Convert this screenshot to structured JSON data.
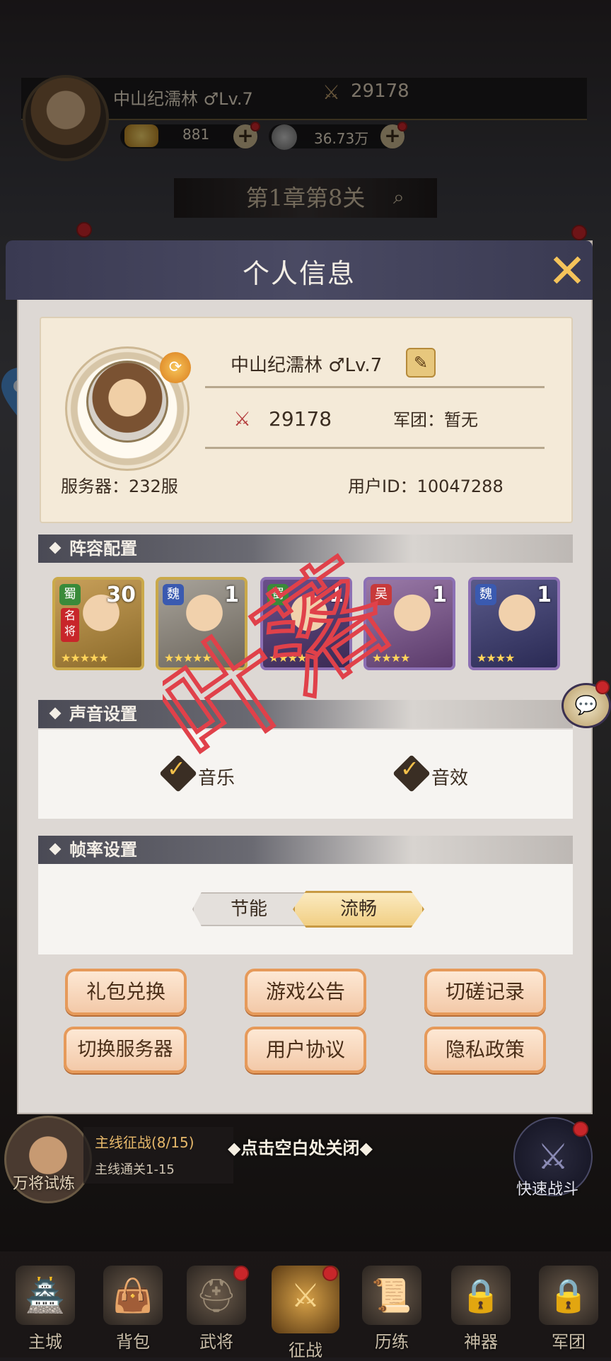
{
  "hud": {
    "name_level": "中山纪濡林 ♂Lv.7",
    "power": "29178",
    "gold": "881",
    "silver": "36.73万",
    "chapter": "第1章第8关"
  },
  "modal": {
    "title": "个人信息",
    "profile": {
      "name_level": "中山纪濡林 ♂Lv.7",
      "power": "29178",
      "legion": "军团：暂无",
      "server": "服务器：232服",
      "uid": "用户ID：10047288"
    },
    "sections": {
      "lineup": "阵容配置",
      "sound": "声音设置",
      "framerate": "帧率设置"
    },
    "heroes": [
      {
        "faction": "蜀",
        "level": "30",
        "badge": "名将",
        "stars": "★★★★★"
      },
      {
        "faction": "魏",
        "level": "1",
        "stars": "★★★★★"
      },
      {
        "faction": "蜀",
        "level": "1",
        "stars": "★★★★"
      },
      {
        "faction": "吴",
        "level": "1",
        "stars": "★★★★"
      },
      {
        "faction": "魏",
        "level": "1",
        "stars": "★★★★"
      }
    ],
    "sound": {
      "music": "音乐",
      "sfx": "音效",
      "music_checked": true,
      "sfx_checked": true
    },
    "framerate": {
      "options": [
        "节能",
        "流畅"
      ],
      "selected": "流畅"
    },
    "buttons": {
      "gift": "礼包兑换",
      "notice": "游戏公告",
      "spar": "切磋记录",
      "switch_server": "切换服务器",
      "agreement": "用户协议",
      "privacy": "隐私政策"
    }
  },
  "watermark": "叶落",
  "below": {
    "close_hint": "◆点击空白处关闭◆",
    "quest_title": "主线征战(8/15)",
    "quest_sub": "主线通关1-15",
    "left_label": "万将试炼",
    "right_label": "快速战斗"
  },
  "nav": [
    "主城",
    "背包",
    "武将",
    "征战",
    "历练",
    "神器",
    "军团"
  ],
  "colors": {
    "accent": "#e69a5a",
    "header": "#3a3a52",
    "watermark": "#e0414a",
    "red_dot": "#c8262a"
  }
}
